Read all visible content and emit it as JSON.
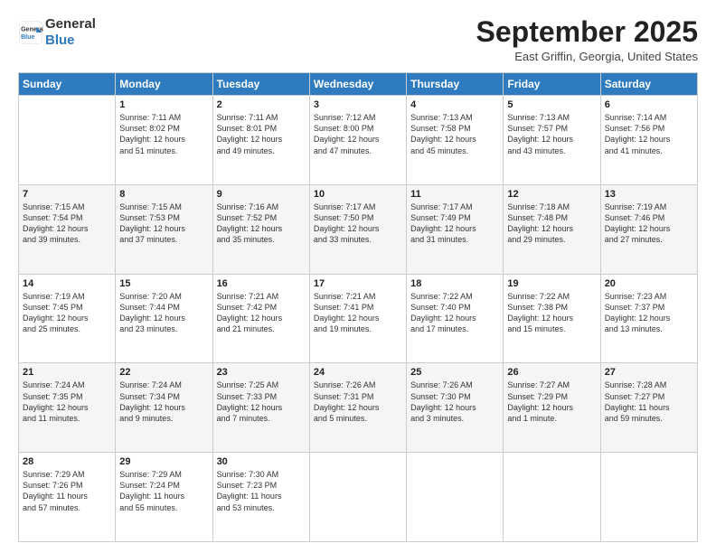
{
  "header": {
    "logo_line1": "General",
    "logo_line2": "Blue",
    "month_title": "September 2025",
    "location": "East Griffin, Georgia, United States"
  },
  "days_of_week": [
    "Sunday",
    "Monday",
    "Tuesday",
    "Wednesday",
    "Thursday",
    "Friday",
    "Saturday"
  ],
  "weeks": [
    [
      {
        "day": "",
        "content": ""
      },
      {
        "day": "1",
        "content": "Sunrise: 7:11 AM\nSunset: 8:02 PM\nDaylight: 12 hours\nand 51 minutes."
      },
      {
        "day": "2",
        "content": "Sunrise: 7:11 AM\nSunset: 8:01 PM\nDaylight: 12 hours\nand 49 minutes."
      },
      {
        "day": "3",
        "content": "Sunrise: 7:12 AM\nSunset: 8:00 PM\nDaylight: 12 hours\nand 47 minutes."
      },
      {
        "day": "4",
        "content": "Sunrise: 7:13 AM\nSunset: 7:58 PM\nDaylight: 12 hours\nand 45 minutes."
      },
      {
        "day": "5",
        "content": "Sunrise: 7:13 AM\nSunset: 7:57 PM\nDaylight: 12 hours\nand 43 minutes."
      },
      {
        "day": "6",
        "content": "Sunrise: 7:14 AM\nSunset: 7:56 PM\nDaylight: 12 hours\nand 41 minutes."
      }
    ],
    [
      {
        "day": "7",
        "content": "Sunrise: 7:15 AM\nSunset: 7:54 PM\nDaylight: 12 hours\nand 39 minutes."
      },
      {
        "day": "8",
        "content": "Sunrise: 7:15 AM\nSunset: 7:53 PM\nDaylight: 12 hours\nand 37 minutes."
      },
      {
        "day": "9",
        "content": "Sunrise: 7:16 AM\nSunset: 7:52 PM\nDaylight: 12 hours\nand 35 minutes."
      },
      {
        "day": "10",
        "content": "Sunrise: 7:17 AM\nSunset: 7:50 PM\nDaylight: 12 hours\nand 33 minutes."
      },
      {
        "day": "11",
        "content": "Sunrise: 7:17 AM\nSunset: 7:49 PM\nDaylight: 12 hours\nand 31 minutes."
      },
      {
        "day": "12",
        "content": "Sunrise: 7:18 AM\nSunset: 7:48 PM\nDaylight: 12 hours\nand 29 minutes."
      },
      {
        "day": "13",
        "content": "Sunrise: 7:19 AM\nSunset: 7:46 PM\nDaylight: 12 hours\nand 27 minutes."
      }
    ],
    [
      {
        "day": "14",
        "content": "Sunrise: 7:19 AM\nSunset: 7:45 PM\nDaylight: 12 hours\nand 25 minutes."
      },
      {
        "day": "15",
        "content": "Sunrise: 7:20 AM\nSunset: 7:44 PM\nDaylight: 12 hours\nand 23 minutes."
      },
      {
        "day": "16",
        "content": "Sunrise: 7:21 AM\nSunset: 7:42 PM\nDaylight: 12 hours\nand 21 minutes."
      },
      {
        "day": "17",
        "content": "Sunrise: 7:21 AM\nSunset: 7:41 PM\nDaylight: 12 hours\nand 19 minutes."
      },
      {
        "day": "18",
        "content": "Sunrise: 7:22 AM\nSunset: 7:40 PM\nDaylight: 12 hours\nand 17 minutes."
      },
      {
        "day": "19",
        "content": "Sunrise: 7:22 AM\nSunset: 7:38 PM\nDaylight: 12 hours\nand 15 minutes."
      },
      {
        "day": "20",
        "content": "Sunrise: 7:23 AM\nSunset: 7:37 PM\nDaylight: 12 hours\nand 13 minutes."
      }
    ],
    [
      {
        "day": "21",
        "content": "Sunrise: 7:24 AM\nSunset: 7:35 PM\nDaylight: 12 hours\nand 11 minutes."
      },
      {
        "day": "22",
        "content": "Sunrise: 7:24 AM\nSunset: 7:34 PM\nDaylight: 12 hours\nand 9 minutes."
      },
      {
        "day": "23",
        "content": "Sunrise: 7:25 AM\nSunset: 7:33 PM\nDaylight: 12 hours\nand 7 minutes."
      },
      {
        "day": "24",
        "content": "Sunrise: 7:26 AM\nSunset: 7:31 PM\nDaylight: 12 hours\nand 5 minutes."
      },
      {
        "day": "25",
        "content": "Sunrise: 7:26 AM\nSunset: 7:30 PM\nDaylight: 12 hours\nand 3 minutes."
      },
      {
        "day": "26",
        "content": "Sunrise: 7:27 AM\nSunset: 7:29 PM\nDaylight: 12 hours\nand 1 minute."
      },
      {
        "day": "27",
        "content": "Sunrise: 7:28 AM\nSunset: 7:27 PM\nDaylight: 11 hours\nand 59 minutes."
      }
    ],
    [
      {
        "day": "28",
        "content": "Sunrise: 7:29 AM\nSunset: 7:26 PM\nDaylight: 11 hours\nand 57 minutes."
      },
      {
        "day": "29",
        "content": "Sunrise: 7:29 AM\nSunset: 7:24 PM\nDaylight: 11 hours\nand 55 minutes."
      },
      {
        "day": "30",
        "content": "Sunrise: 7:30 AM\nSunset: 7:23 PM\nDaylight: 11 hours\nand 53 minutes."
      },
      {
        "day": "",
        "content": ""
      },
      {
        "day": "",
        "content": ""
      },
      {
        "day": "",
        "content": ""
      },
      {
        "day": "",
        "content": ""
      }
    ]
  ]
}
